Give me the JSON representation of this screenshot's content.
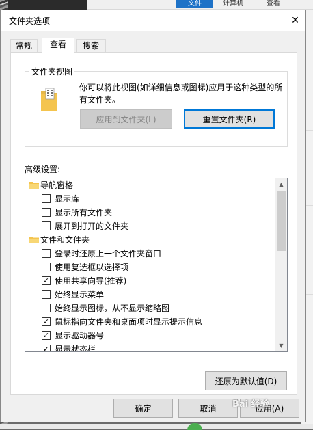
{
  "background": {
    "tabs": [
      "文件",
      "计算机",
      "查看"
    ],
    "watermark": "Bai 经验"
  },
  "dialog": {
    "title": "文件夹选项",
    "close_glyph": "✕",
    "tabs": [
      {
        "label": "常规",
        "active": false
      },
      {
        "label": "查看",
        "active": true
      },
      {
        "label": "搜索",
        "active": false
      }
    ],
    "folder_views": {
      "title": "文件夹视图",
      "description": "你可以将此视图(如详细信息或图标)应用于这种类型的所有文件夹。",
      "apply_button": "应用到文件夹(L)",
      "reset_button": "重置文件夹(R)"
    },
    "advanced_label": "高级设置:",
    "advanced_items": [
      {
        "type": "folder",
        "label": "导航窗格"
      },
      {
        "type": "checkbox",
        "label": "显示库",
        "checked": false
      },
      {
        "type": "checkbox",
        "label": "显示所有文件夹",
        "checked": false
      },
      {
        "type": "checkbox",
        "label": "展开到打开的文件夹",
        "checked": false
      },
      {
        "type": "folder",
        "label": "文件和文件夹"
      },
      {
        "type": "checkbox",
        "label": "登录时还原上一个文件夹窗口",
        "checked": false
      },
      {
        "type": "checkbox",
        "label": "使用复选框以选择项",
        "checked": false
      },
      {
        "type": "checkbox",
        "label": "使用共享向导(推荐)",
        "checked": true
      },
      {
        "type": "checkbox",
        "label": "始终显示菜单",
        "checked": false
      },
      {
        "type": "checkbox",
        "label": "始终显示图标，从不显示缩略图",
        "checked": false
      },
      {
        "type": "checkbox",
        "label": "鼠标指向文件夹和桌面项时显示提示信息",
        "checked": true
      },
      {
        "type": "checkbox",
        "label": "显示驱动器号",
        "checked": true
      },
      {
        "type": "checkbox",
        "label": "显示状态栏",
        "checked": true
      }
    ],
    "restore_defaults_button": "还原为默认值(D)",
    "ok_button": "确定",
    "cancel_button": "取消",
    "apply_button": "应用(A)",
    "scroll_up": "▲",
    "scroll_down": "▼",
    "check_glyph": "✓"
  },
  "colors": {
    "accent": "#0078d7",
    "folder": "#f4c44e"
  }
}
